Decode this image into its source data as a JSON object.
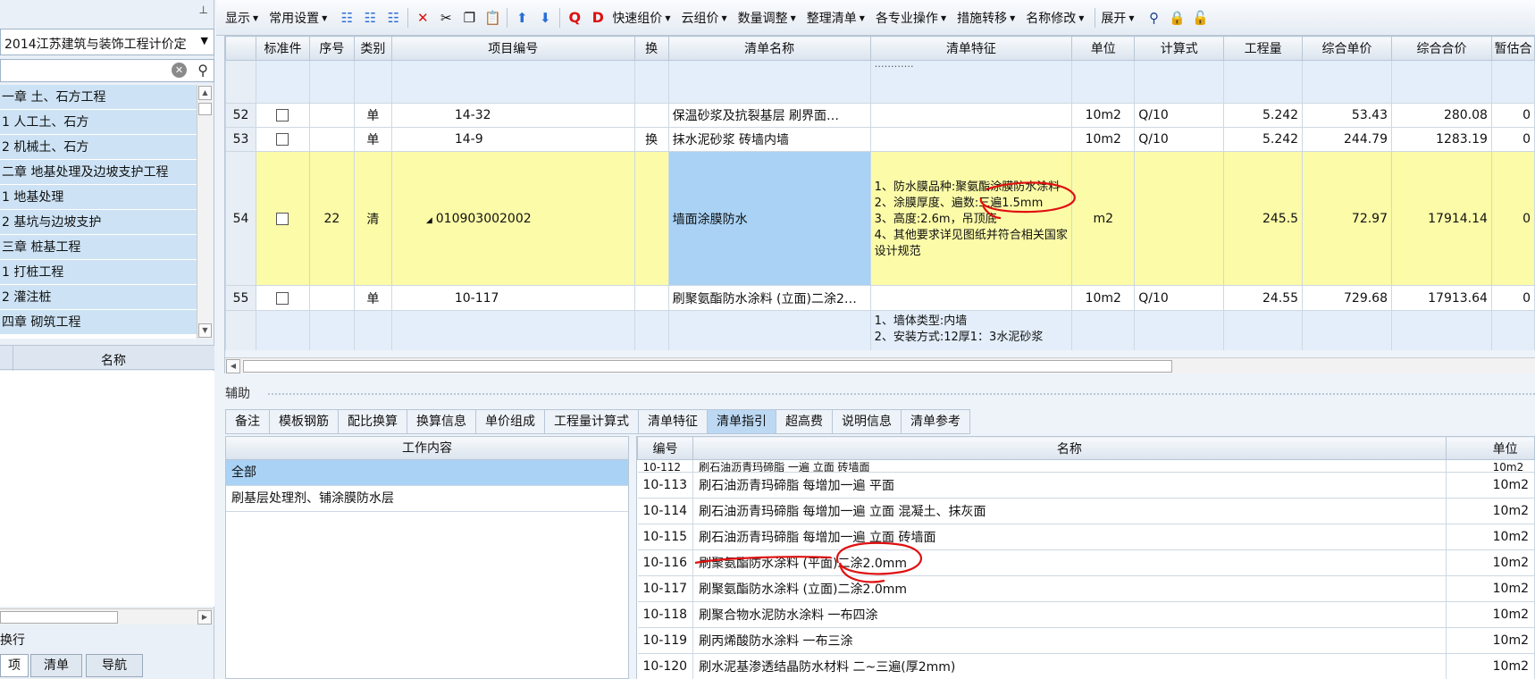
{
  "left_panel": {
    "quota_library": "2014江苏建筑与装饰工程计价定",
    "search_placeholder": "",
    "tree_items": [
      "一章 土、石方工程",
      "1 人工土、石方",
      "2 机械土、石方",
      "二章 地基处理及边坡支护工程",
      "1 地基处理",
      "2 基坑与边坡支护",
      "三章 桩基工程",
      "1 打桩工程",
      "2 灌注桩",
      "四章 砌筑工程"
    ],
    "name_column": "名称",
    "wrap_option": "换行",
    "bottom_tabs": [
      "项",
      "清单",
      "导航"
    ]
  },
  "toolbar": {
    "menus": [
      "显示",
      "常用设置",
      "快速组价",
      "云组价",
      "数量调整",
      "整理清单",
      "各专业操作",
      "措施转移",
      "名称修改",
      "展开"
    ],
    "q_label": "Q",
    "d_label": "D"
  },
  "grid": {
    "columns": [
      "标准件",
      "序号",
      "类别",
      "项目编号",
      "换",
      "清单名称",
      "清单特征",
      "单位",
      "计算式",
      "工程量",
      "综合单价",
      "综合合价",
      "暂估合"
    ],
    "top_partial_feature": "…………",
    "rows": [
      {
        "rn": "52",
        "seq": "",
        "type": "单",
        "code": "14-32",
        "swap": "",
        "name": "保温砂浆及抗裂基层 刷界面…",
        "feature": "",
        "unit": "10m2",
        "formula": "Q/10",
        "qty": "5.242",
        "unit_price": "53.43",
        "total": "280.08",
        "est": "0"
      },
      {
        "rn": "53",
        "seq": "",
        "type": "单",
        "code": "14-9",
        "swap": "换",
        "name": "抹水泥砂浆 砖墙内墙",
        "feature": "",
        "unit": "10m2",
        "formula": "Q/10",
        "qty": "5.242",
        "unit_price": "244.79",
        "total": "1283.19",
        "est": "0"
      },
      {
        "rn": "54",
        "seq": "22",
        "type": "清",
        "code": "010903002002",
        "swap": "",
        "name": "墙面涂膜防水",
        "feature_lines": [
          "1、防水膜品种:聚氨酯涂膜防水涂料",
          "2、涂膜厚度、遍数:三遍1.5mm",
          "3、高度:2.6m，吊顶底",
          "4、其他要求详见图纸并符合相关国家设计规范"
        ],
        "unit": "m2",
        "formula": "",
        "qty": "245.5",
        "unit_price": "72.97",
        "total": "17914.14",
        "est": "0"
      },
      {
        "rn": "55",
        "seq": "",
        "type": "单",
        "code": "10-117",
        "swap": "",
        "name": "刷聚氨酯防水涂料 (立面)二涂2…",
        "feature": "",
        "unit": "10m2",
        "formula": "Q/10",
        "qty": "24.55",
        "unit_price": "729.68",
        "total": "17913.64",
        "est": "0"
      }
    ],
    "partial_row_feature_lines": [
      "1、墙体类型:内墙",
      "2、安装方式:12厚1：3水泥砂浆"
    ]
  },
  "assist": {
    "title": "辅助",
    "tabs": [
      "备注",
      "模板钢筋",
      "配比换算",
      "换算信息",
      "单价组成",
      "工程量计算式",
      "清单特征",
      "清单指引",
      "超高费",
      "说明信息",
      "清单参考"
    ],
    "active_tab": "清单指引",
    "work_header": "工作内容",
    "work_items": [
      "全部",
      "刷基层处理剂、铺涂膜防水层"
    ],
    "guide_columns": [
      "编号",
      "名称",
      "单位"
    ],
    "guide_partial": {
      "code": "10-112",
      "name": "刷石油沥青玛碲脂 一遍 立面 砖墙面",
      "unit": "10m2"
    },
    "guide_rows": [
      {
        "code": "10-113",
        "name": "刷石油沥青玛碲脂 每增加一遍 平面",
        "unit": "10m2"
      },
      {
        "code": "10-114",
        "name": "刷石油沥青玛碲脂 每增加一遍 立面 混凝土、抹灰面",
        "unit": "10m2"
      },
      {
        "code": "10-115",
        "name": "刷石油沥青玛碲脂 每增加一遍 立面 砖墙面",
        "unit": "10m2"
      },
      {
        "code": "10-116",
        "name": "刷聚氨酯防水涂料 (平面)二涂2.0mm",
        "unit": "10m2"
      },
      {
        "code": "10-117",
        "name": "刷聚氨酯防水涂料 (立面)二涂2.0mm",
        "unit": "10m2"
      },
      {
        "code": "10-118",
        "name": "刷聚合物水泥防水涂料 一布四涂",
        "unit": "10m2"
      },
      {
        "code": "10-119",
        "name": "刷丙烯酸防水涂料 一布三涂",
        "unit": "10m2"
      },
      {
        "code": "10-120",
        "name": "刷水泥基渗透结晶防水材料 二~三遍(厚2mm)",
        "unit": "10m2"
      }
    ]
  },
  "colors": {
    "accent": "#a9d2f5",
    "highlight_row": "#fbfba8",
    "annotation": "#e01010"
  }
}
